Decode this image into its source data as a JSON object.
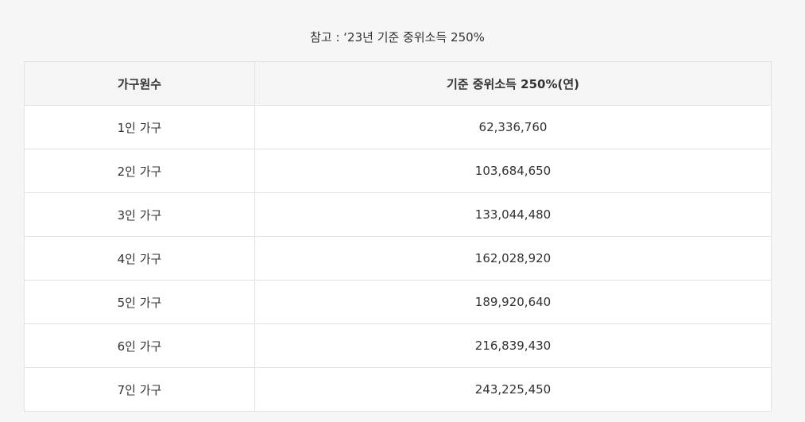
{
  "caption": "참고 : ‘23년 기준 중위소득 250%",
  "table": {
    "headers": [
      "가구원수",
      "기준 중위소득 250%(연)"
    ],
    "rows": [
      {
        "household": "1인 가구",
        "amount": "62,336,760"
      },
      {
        "household": "2인 가구",
        "amount": "103,684,650"
      },
      {
        "household": "3인 가구",
        "amount": "133,044,480"
      },
      {
        "household": "4인 가구",
        "amount": "162,028,920"
      },
      {
        "household": "5인 가구",
        "amount": "189,920,640"
      },
      {
        "household": "6인 가구",
        "amount": "216,839,430"
      },
      {
        "household": "7인 가구",
        "amount": "243,225,450"
      }
    ]
  },
  "colors": {
    "background": "#f6f6f6",
    "header_background": "#f5f5f5",
    "cell_background": "#ffffff",
    "border": "#e3e3e3",
    "text": "#333333"
  }
}
